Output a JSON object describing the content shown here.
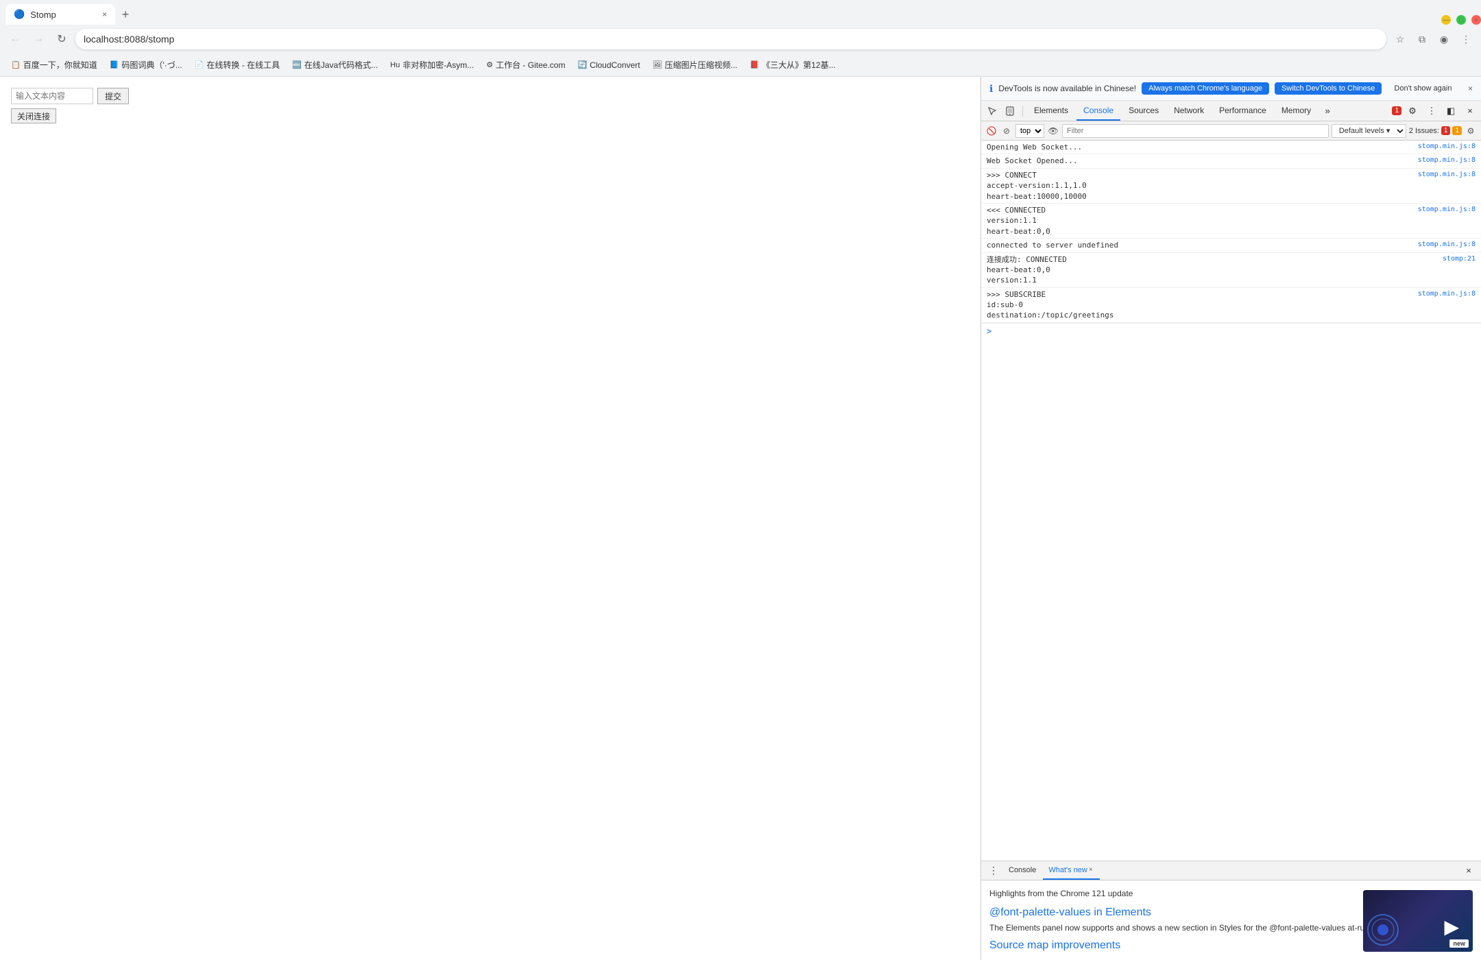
{
  "browser": {
    "tab": {
      "favicon": "🔵",
      "title": "Stomp",
      "close_icon": "×"
    },
    "new_tab_icon": "+",
    "window_controls": {
      "minimize": "—",
      "maximize": "□",
      "close": "×"
    },
    "address_bar": {
      "back_icon": "←",
      "forward_icon": "→",
      "reload_icon": "↻",
      "url": "localhost:8088/stomp",
      "star_icon": "☆",
      "extensions_icon": "⧉",
      "profile_icon": "◉",
      "menu_icon": "⋮"
    },
    "bookmarks": [
      {
        "icon": "📋",
        "label": "百度一下，你就知道"
      },
      {
        "icon": "📘",
        "label": "码图词典（'·づ..."
      },
      {
        "icon": "📄",
        "label": "在线转换 - 在线工具"
      },
      {
        "icon": "🔤",
        "label": "在线Java代码格式..."
      },
      {
        "icon": "🔷",
        "label": "非对称加密-Asym..."
      },
      {
        "icon": "⚙️",
        "label": "工作台 - Gitee.com"
      },
      {
        "icon": "🔄",
        "label": "CloudConvert"
      },
      {
        "icon": "🖼️",
        "label": "压缩图片压缩视频..."
      },
      {
        "icon": "📕",
        "label": "《三大从》第12基..."
      }
    ]
  },
  "page": {
    "input_placeholder": "输入文本内容",
    "submit_label": "提交",
    "close_label": "关闭连接"
  },
  "devtools": {
    "notification": {
      "icon": "ℹ",
      "text": "DevTools is now available in Chinese!",
      "btn_always": "Always match Chrome's language",
      "btn_switch": "Switch DevTools to Chinese",
      "btn_dismiss": "Don't show again",
      "close_icon": "×"
    },
    "tabs": [
      {
        "label": "Elements",
        "active": false
      },
      {
        "label": "Console",
        "active": true
      },
      {
        "label": "Sources",
        "active": false
      },
      {
        "label": "Network",
        "active": false
      },
      {
        "label": "Performance",
        "active": false
      },
      {
        "label": "Memory",
        "active": false
      }
    ],
    "more_tabs_icon": "»",
    "toolbar_right": {
      "errors_badge": "1",
      "settings_icon": "⚙",
      "more_icon": "⋮",
      "close_icon": "×",
      "dock_icon": "◧"
    },
    "console_toolbar": {
      "clear_icon": "🚫",
      "filter_placeholder": "Filter",
      "default_levels": "Default levels ▾",
      "issues_label": "2 Issues:",
      "error_badge": "1",
      "warning_badge": "1",
      "settings_icon": "⚙",
      "eye_icon": "👁",
      "top_context": "top"
    },
    "log_entries": [
      {
        "text": "Opening Web Socket...",
        "source": "stomp.min.js:8"
      },
      {
        "text": "Web Socket Opened...",
        "source": "stomp.min.js:8"
      },
      {
        "text": ">>> CONNECT\naccept-version:1.1,1.0\nheart-beat:10000,10000",
        "source": "stomp.min.js:8"
      },
      {
        "text": "<<< CONNECTED\nversion:1.1\nheart-beat:0,0",
        "source": "stomp.min.js:8"
      },
      {
        "text": "connected to server undefined",
        "source": "stomp.min.js:8"
      },
      {
        "text": "连接成功: CONNECTED\nheart-beat:0,0\nversion:1.1",
        "source": "stomp:21"
      },
      {
        "text": ">>> SUBSCRIBE\nid:sub-0\ndestination:/topic/greetings",
        "source": "stomp.min.js:8"
      }
    ],
    "prompt_arrow": ">",
    "bottom_panel": {
      "tabs": [
        {
          "label": "Console",
          "active": false
        },
        {
          "label": "What's new",
          "active": true,
          "closeable": true
        }
      ],
      "more_icon": "⋮",
      "close_icon": "×",
      "highlights_text": "Highlights from the Chrome 121 update",
      "section1_title": "@font-palette-values in Elements",
      "section1_text": "The Elements panel now supports and shows a new\nsection in Styles for the @font-palette-values at-rule.",
      "section2_title": "Source map improvements",
      "video_play_icon": "▶",
      "video_new_label": "new"
    }
  }
}
